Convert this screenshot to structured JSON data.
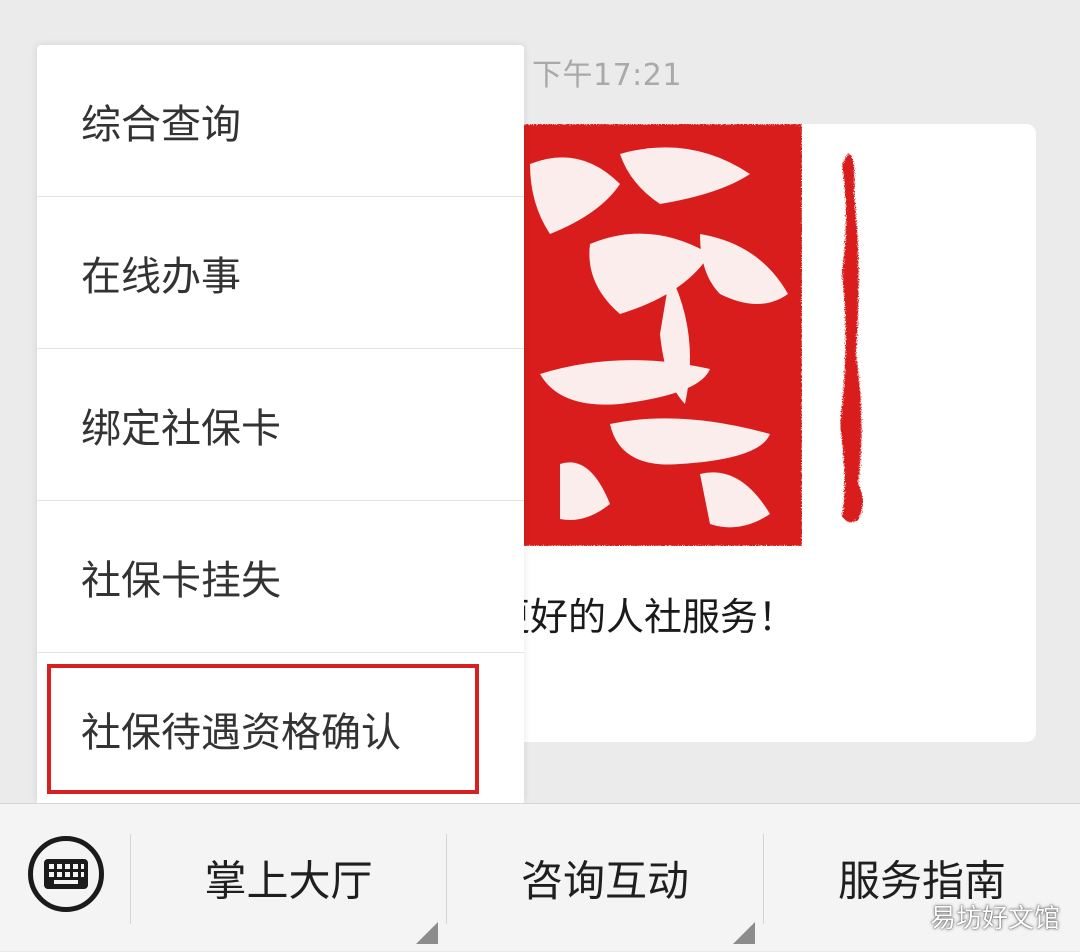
{
  "chat": {
    "timestamp": "下午17:21",
    "article": {
      "title": "更好的人社服务！",
      "subtitle": "秋！"
    }
  },
  "popup_menu": {
    "items": [
      {
        "label": "综合查询"
      },
      {
        "label": "在线办事"
      },
      {
        "label": "绑定社保卡"
      },
      {
        "label": "社保卡挂失"
      },
      {
        "label": "社保待遇资格确认"
      }
    ],
    "highlighted_index": 4,
    "highlight_color": "#d72121"
  },
  "bottom_bar": {
    "keyboard_icon": "keyboard-icon",
    "tabs": [
      {
        "label": "掌上大厅"
      },
      {
        "label": "咨询互动"
      },
      {
        "label": "服务指南"
      }
    ]
  },
  "watermark": "易坊好文馆",
  "colors": {
    "seal_red": "#d91d1d",
    "background": "#ebebeb"
  }
}
